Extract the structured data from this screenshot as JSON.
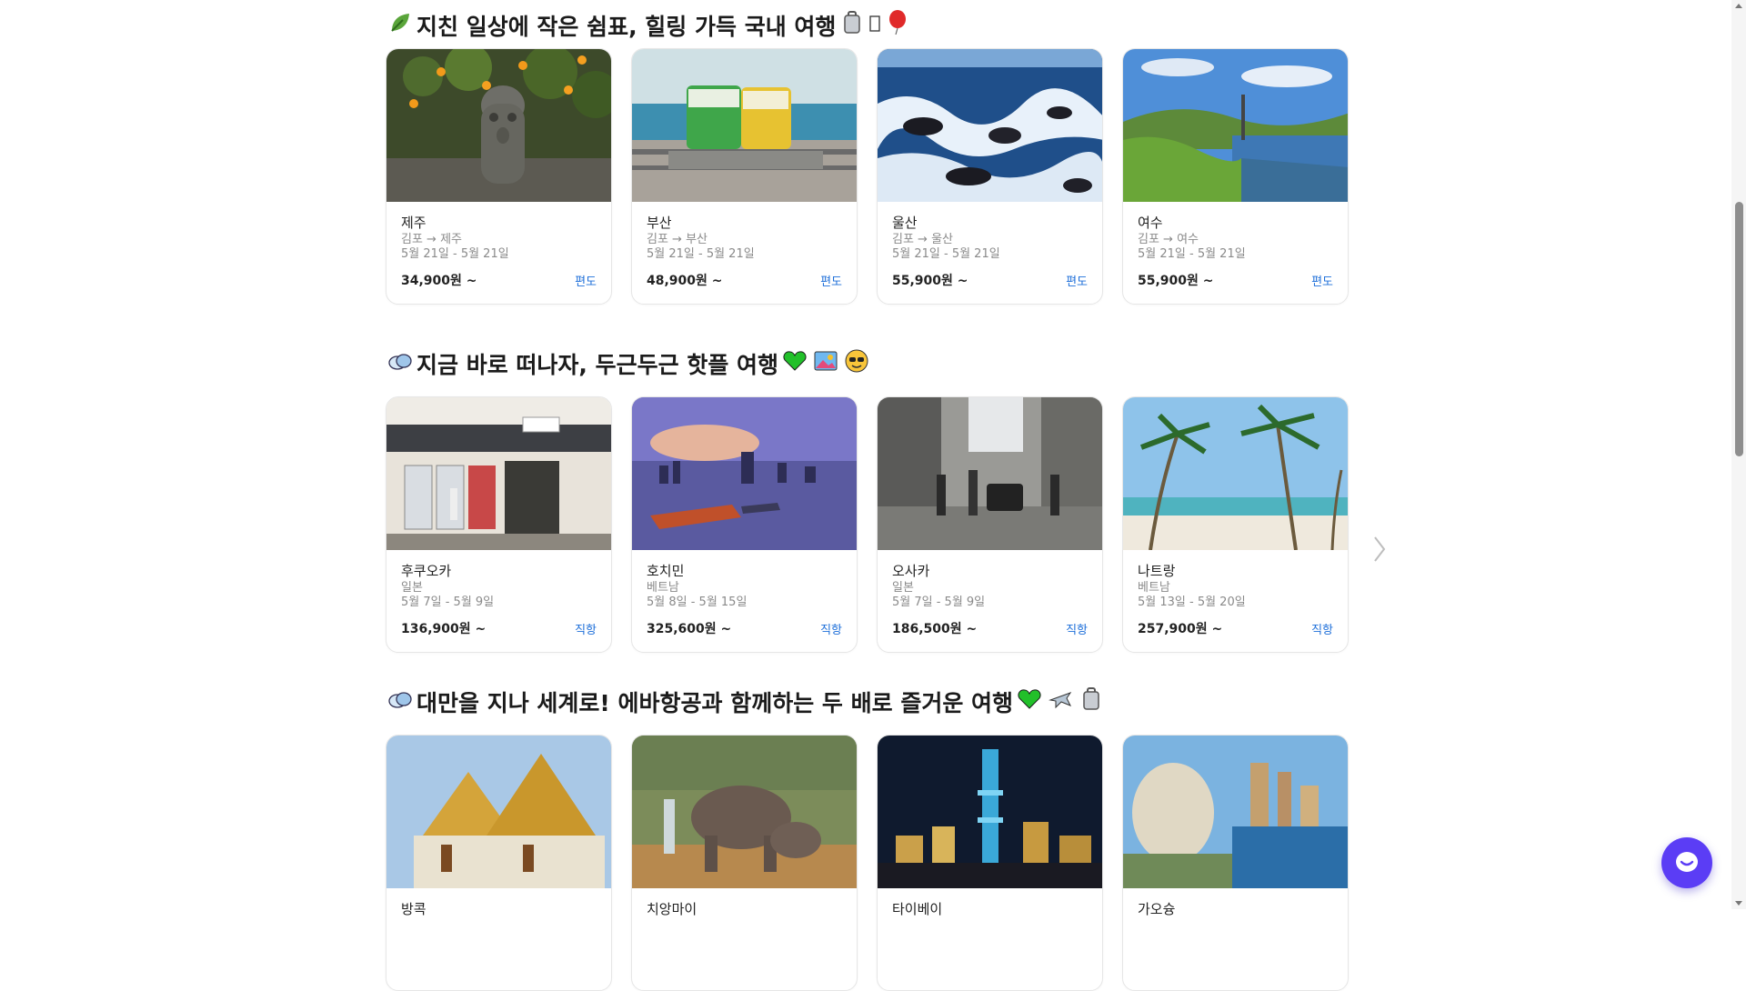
{
  "sections": [
    {
      "title": "지친 일상에 작은 쉼표, 힐링 가득 국내 여행",
      "lead_emoji": "leaf-icon",
      "trail_emojis": [
        "luggage-icon",
        "missing-glyph",
        "balloon-icon"
      ],
      "cards": [
        {
          "name": "제주",
          "route": "김포 → 제주",
          "date": "5월 21일 - 5월 21일",
          "price": "34,900원 ~",
          "tag": "편도",
          "image": "jeju-stone-statue-image"
        },
        {
          "name": "부산",
          "route": "김포 → 부산",
          "date": "5월 21일 - 5월 21일",
          "price": "48,900원 ~",
          "tag": "편도",
          "image": "busan-beach-train-image"
        },
        {
          "name": "울산",
          "route": "김포 → 울산",
          "date": "5월 21일 - 5월 21일",
          "price": "55,900원 ~",
          "tag": "편도",
          "image": "ulsan-rocky-sea-image"
        },
        {
          "name": "여수",
          "route": "김포 → 여수",
          "date": "5월 21일 - 5월 21일",
          "price": "55,900원 ~",
          "tag": "편도",
          "image": "yeosu-harbor-image"
        }
      ]
    },
    {
      "title": "지금 바로 떠나자, 두근두근 핫플 여행",
      "lead_emoji": "cloud-icon",
      "trail_emojis": [
        "green-heart-icon",
        "picture-icon",
        "sunglasses-face-icon"
      ],
      "cards": [
        {
          "name": "후쿠오카",
          "route": "일본",
          "date": "5월 7일 - 5월 9일",
          "price": "136,900원 ~",
          "tag": "직항",
          "image": "fukuoka-shopfront-image"
        },
        {
          "name": "호치민",
          "route": "베트남",
          "date": "5월 8일 - 5월 15일",
          "price": "325,600원 ~",
          "tag": "직항",
          "image": "hochiminh-river-skyline-image"
        },
        {
          "name": "오사카",
          "route": "일본",
          "date": "5월 7일 - 5월 9일",
          "price": "186,500원 ~",
          "tag": "직항",
          "image": "osaka-street-image"
        },
        {
          "name": "나트랑",
          "route": "베트남",
          "date": "5월 13일 - 5월 20일",
          "price": "257,900원 ~",
          "tag": "직항",
          "image": "nhatrang-palm-beach-image"
        }
      ]
    },
    {
      "title": "대만을 지나 세계로! 에바항공과 함께하는 두 배로 즐거운 여행",
      "lead_emoji": "cloud-icon",
      "trail_emojis": [
        "green-heart-icon",
        "airplane-icon",
        "luggage-icon"
      ],
      "cards": [
        {
          "name": "방콕",
          "image": "bangkok-temple-image"
        },
        {
          "name": "치앙마이",
          "image": "chiangmai-elephants-image"
        },
        {
          "name": "타이베이",
          "image": "taipei-night-skyline-image"
        },
        {
          "name": "가오슝",
          "image": "kaohsiung-harbor-image"
        }
      ]
    }
  ],
  "next_arrow": "chevron-right-icon",
  "chat_button": "chat-bubble-icon"
}
